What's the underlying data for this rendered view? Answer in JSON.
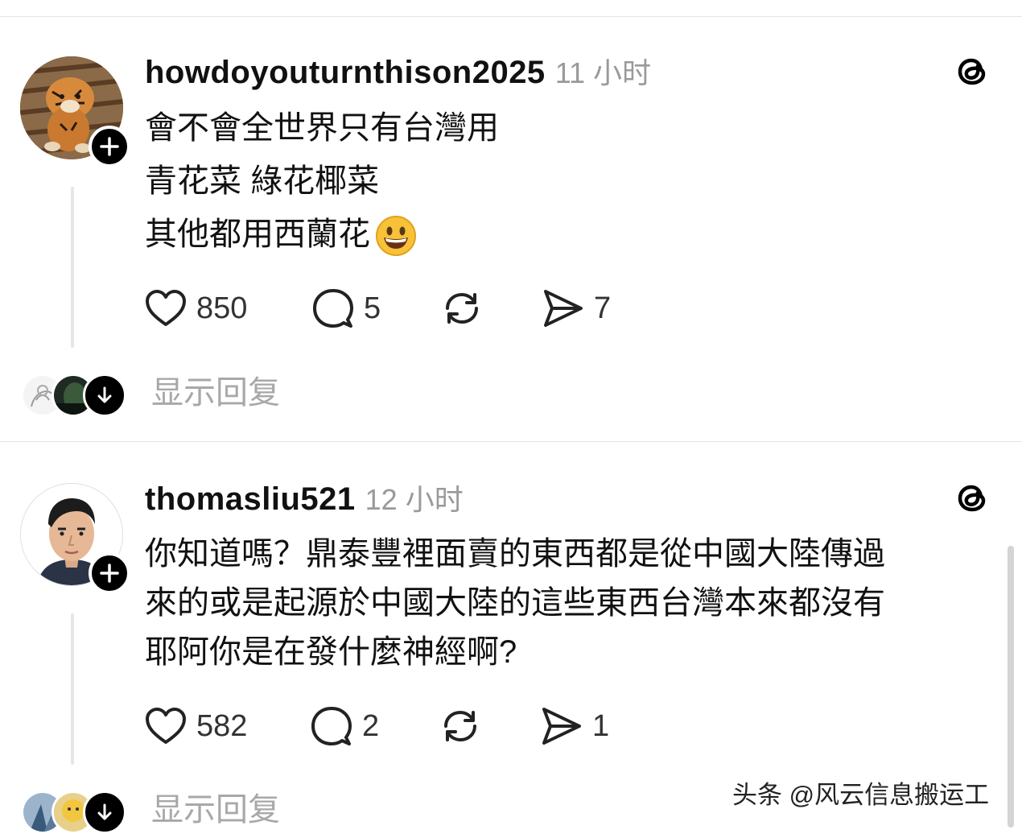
{
  "posts": [
    {
      "username": "howdoyouturnthison2025",
      "time": "11 小时",
      "lines": [
        "會不會全世界只有台灣用",
        "青花菜 綠花椰菜",
        "其他都用西蘭花"
      ],
      "emoji_icon": "grinning-face-emoji",
      "likes": "850",
      "comments": "5",
      "shares": "7",
      "show_replies": "显示回复"
    },
    {
      "username": "thomasliu521",
      "time": "12 小时",
      "lines": [
        "你知道嗎？鼎泰豐裡面賣的東西都是從中國大陸傳過",
        "來的或是起源於中國大陸的這些東西台灣本來都沒有",
        "耶阿你是在發什麼神經啊?"
      ],
      "likes": "582",
      "comments": "2",
      "shares": "1",
      "show_replies": "显示回复"
    }
  ],
  "watermark": "头条 @风云信息搬运工",
  "icons": {
    "like": "heart-icon",
    "comment": "speech-bubble-icon",
    "repost": "repost-arrows-icon",
    "share": "send-icon",
    "app": "threads-logo-icon",
    "follow": "plus-icon",
    "expand": "arrow-down-icon"
  },
  "colors": {
    "text": "#111111",
    "muted": "#9a9a9a",
    "button": "#000000",
    "divider": "#e4e4e4"
  }
}
